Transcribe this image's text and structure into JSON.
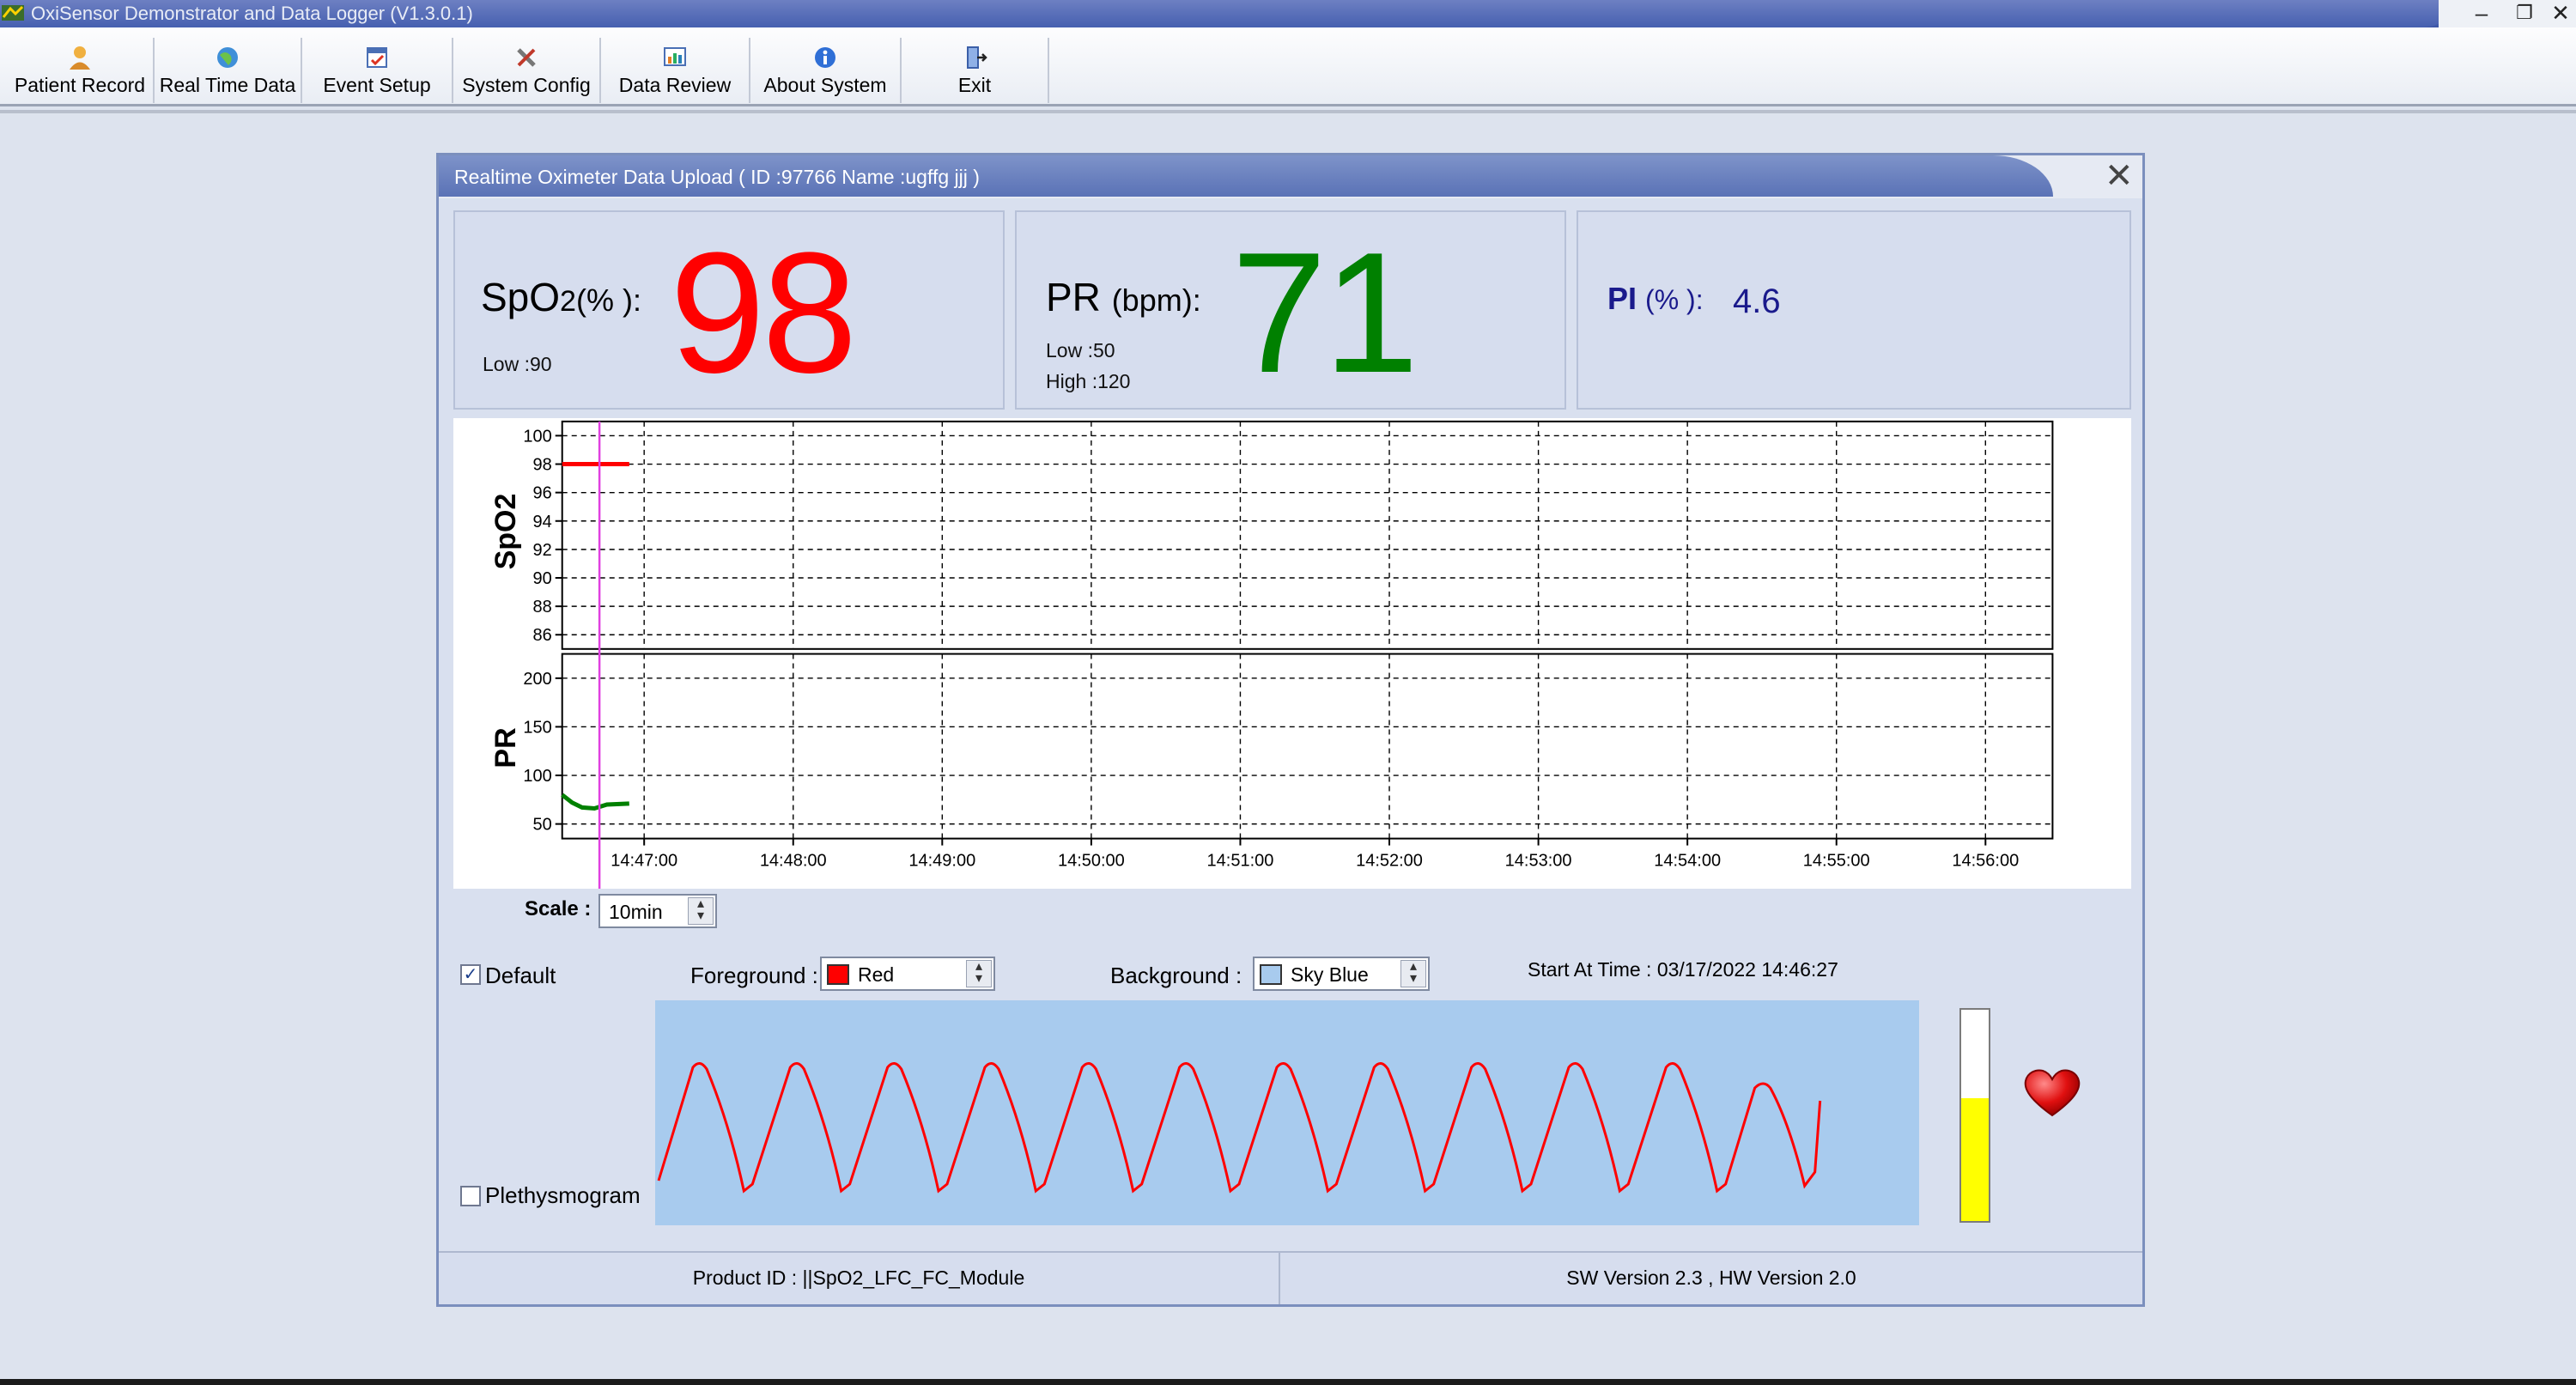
{
  "window": {
    "title": "OxiSensor Demonstrator and Data Logger (V1.3.0.1)"
  },
  "toolbar": {
    "items": [
      {
        "label": "Patient Record",
        "icon": "patient-icon"
      },
      {
        "label": "Real Time Data",
        "icon": "globe-icon"
      },
      {
        "label": "Event Setup",
        "icon": "event-icon"
      },
      {
        "label": "System Config",
        "icon": "tools-icon"
      },
      {
        "label": "Data Review",
        "icon": "review-icon"
      },
      {
        "label": "About System",
        "icon": "info-icon"
      },
      {
        "label": "Exit",
        "icon": "exit-door-icon"
      }
    ]
  },
  "dialog": {
    "title": "Realtime Oximeter Data Upload   ( ID :97766   Name :ugffg jjj )",
    "spo2": {
      "label_prefix": "SpO",
      "label_sub": "2",
      "label_suffix": "(% ):",
      "value": "98",
      "low": "Low :90",
      "value_color": "#ff0000"
    },
    "pr": {
      "label": "PR",
      "unit": "(bpm):",
      "value": "71",
      "low": "Low :50",
      "high": "High :120",
      "value_color": "#008000"
    },
    "pi": {
      "label": "PI",
      "unit": "(% ):",
      "value": "4.6",
      "color": "#1a1a8c"
    },
    "scale": {
      "label": "Scale :",
      "value": "10min"
    },
    "default_checkbox": {
      "label": "Default",
      "checked": true
    },
    "plethysmogram_checkbox": {
      "label": "Plethysmogram",
      "checked": false
    },
    "foreground": {
      "label": "Foreground :",
      "value": "Red",
      "color": "#ff0000"
    },
    "background": {
      "label": "Background :",
      "value": "Sky Blue",
      "color": "#a8cbee"
    },
    "start_time": "Start At Time : 03/17/2022   14:46:27",
    "signal_level": 0.58,
    "status": {
      "product": "Product ID : ||SpO2_LFC_FC_Module",
      "version": "SW Version 2.3  ,  HW Version 2.0"
    }
  },
  "chart_data": {
    "type": "line",
    "x_ticks": [
      "14:47:00",
      "14:48:00",
      "14:49:00",
      "14:50:00",
      "14:51:00",
      "14:52:00",
      "14:53:00",
      "14:54:00",
      "14:55:00",
      "14:56:00"
    ],
    "xlim": [
      "14:46:27",
      "14:56:27"
    ],
    "cursor_time": "14:46:42",
    "grid": true,
    "panels": [
      {
        "ylabel": "SpO2",
        "ylim": [
          85,
          101
        ],
        "y_ticks": [
          100,
          98,
          96,
          94,
          92,
          90,
          88,
          86
        ],
        "color": "#ff0000",
        "series": {
          "t": [
            "14:46:27",
            "14:46:35",
            "14:46:42",
            "14:46:50",
            "14:46:54"
          ],
          "values": [
            98,
            98,
            98,
            98,
            98
          ]
        }
      },
      {
        "ylabel": "PR",
        "ylim": [
          35,
          225
        ],
        "y_ticks": [
          200,
          150,
          100,
          50
        ],
        "color": "#008000",
        "series": {
          "t": [
            "14:46:27",
            "14:46:31",
            "14:46:35",
            "14:46:40",
            "14:46:45",
            "14:46:54"
          ],
          "values": [
            80,
            72,
            67,
            66,
            70,
            71
          ]
        }
      }
    ]
  },
  "pleth_wave": {
    "color": "#ff0000",
    "beats": 12
  }
}
